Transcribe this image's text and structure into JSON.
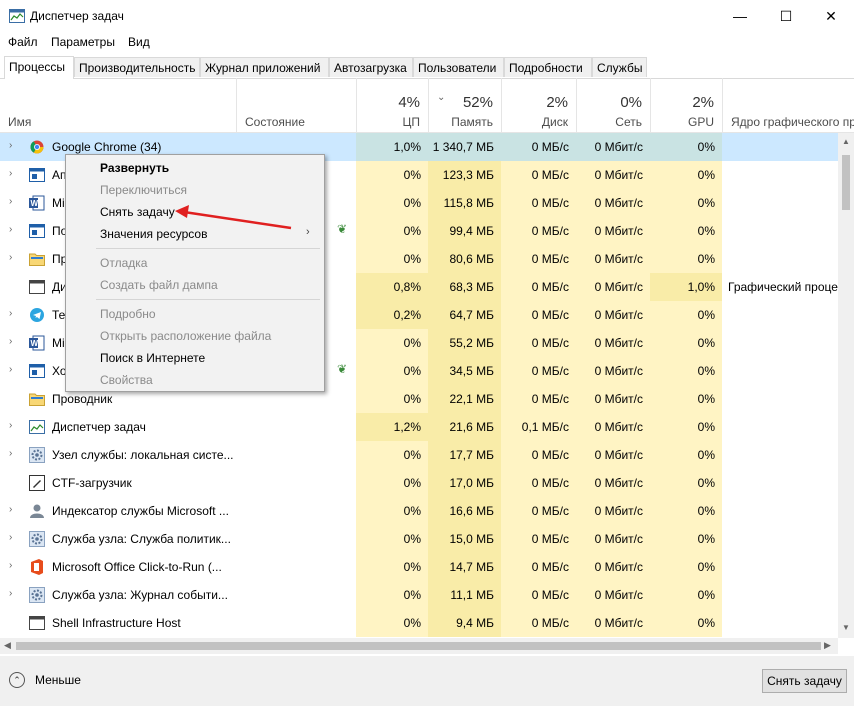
{
  "window": {
    "title": "Диспетчер задач",
    "minimize": "—",
    "maximize": "☐",
    "close": "✕"
  },
  "menu": [
    "Файл",
    "Параметры",
    "Вид"
  ],
  "tabs": [
    "Процессы",
    "Производительность",
    "Журнал приложений",
    "Автозагрузка",
    "Пользователи",
    "Подробности",
    "Службы"
  ],
  "columns": {
    "name": "Имя",
    "status": "Состояние",
    "cpu": {
      "pct": "4%",
      "label": "ЦП"
    },
    "mem": {
      "pct": "52%",
      "label": "Память"
    },
    "disk": {
      "pct": "2%",
      "label": "Диск"
    },
    "net": {
      "pct": "0%",
      "label": "Сеть"
    },
    "gpu": {
      "pct": "2%",
      "label": "GPU"
    },
    "engine": "Ядро графического процессора"
  },
  "processes": [
    {
      "name": "Google Chrome (34)",
      "cpu": "1,0%",
      "mem": "1 340,7 МБ",
      "disk": "0 МБ/с",
      "net": "0 Мбит/с",
      "gpu": "0%",
      "engine": "",
      "icon": "chrome-icon"
    },
    {
      "name": "Ап",
      "cpu": "0%",
      "mem": "123,3 МБ",
      "disk": "0 МБ/с",
      "net": "0 Мбит/с",
      "gpu": "0%",
      "engine": "",
      "icon": "app-window-icon"
    },
    {
      "name": "Mi",
      "cpu": "0%",
      "mem": "115,8 МБ",
      "disk": "0 МБ/с",
      "net": "0 Мбит/с",
      "gpu": "0%",
      "engine": "",
      "icon": "word-icon"
    },
    {
      "name": "По",
      "cpu": "0%",
      "mem": "99,4 МБ",
      "disk": "0 МБ/с",
      "net": "0 Мбит/с",
      "gpu": "0%",
      "engine": "",
      "icon": "app-window-icon",
      "leaf": true
    },
    {
      "name": "Пр",
      "cpu": "0%",
      "mem": "80,6 МБ",
      "disk": "0 МБ/с",
      "net": "0 Мбит/с",
      "gpu": "0%",
      "engine": "",
      "icon": "folder-icon"
    },
    {
      "name": "Ди",
      "cpu": "0,8%",
      "mem": "68,3 МБ",
      "disk": "0 МБ/с",
      "net": "0 Мбит/с",
      "gpu": "1,0%",
      "engine": "Графический процессор",
      "icon": "window-icon"
    },
    {
      "name": "Те",
      "cpu": "0,2%",
      "mem": "64,7 МБ",
      "disk": "0 МБ/с",
      "net": "0 Мбит/с",
      "gpu": "0%",
      "engine": "",
      "icon": "telegram-icon"
    },
    {
      "name": "Mi",
      "cpu": "0%",
      "mem": "55,2 МБ",
      "disk": "0 МБ/с",
      "net": "0 Мбит/с",
      "gpu": "0%",
      "engine": "",
      "icon": "word-icon"
    },
    {
      "name": "Хо",
      "cpu": "0%",
      "mem": "34,5 МБ",
      "disk": "0 МБ/с",
      "net": "0 Мбит/с",
      "gpu": "0%",
      "engine": "",
      "icon": "app-window-icon",
      "leaf": true
    },
    {
      "name": "Проводник",
      "cpu": "0%",
      "mem": "22,1 МБ",
      "disk": "0 МБ/с",
      "net": "0 Мбит/с",
      "gpu": "0%",
      "engine": "",
      "icon": "folder-icon"
    },
    {
      "name": "Диспетчер задач",
      "cpu": "1,2%",
      "mem": "21,6 МБ",
      "disk": "0,1 МБ/с",
      "net": "0 Мбит/с",
      "gpu": "0%",
      "engine": "",
      "icon": "taskmgr-icon"
    },
    {
      "name": "Узел службы: локальная систе...",
      "cpu": "0%",
      "mem": "17,7 МБ",
      "disk": "0 МБ/с",
      "net": "0 Мбит/с",
      "gpu": "0%",
      "engine": "",
      "icon": "gear-icon"
    },
    {
      "name": "CTF-загрузчик",
      "cpu": "0%",
      "mem": "17,0 МБ",
      "disk": "0 МБ/с",
      "net": "0 Мбит/с",
      "gpu": "0%",
      "engine": "",
      "icon": "pen-icon"
    },
    {
      "name": "Индексатор службы Microsoft ...",
      "cpu": "0%",
      "mem": "16,6 МБ",
      "disk": "0 МБ/с",
      "net": "0 Мбит/с",
      "gpu": "0%",
      "engine": "",
      "icon": "user-icon"
    },
    {
      "name": "Служба узла: Служба политик...",
      "cpu": "0%",
      "mem": "15,0 МБ",
      "disk": "0 МБ/с",
      "net": "0 Мбит/с",
      "gpu": "0%",
      "engine": "",
      "icon": "gear-icon"
    },
    {
      "name": "Microsoft Office Click-to-Run (...",
      "cpu": "0%",
      "mem": "14,7 МБ",
      "disk": "0 МБ/с",
      "net": "0 Мбит/с",
      "gpu": "0%",
      "engine": "",
      "icon": "office-icon"
    },
    {
      "name": "Служба узла: Журнал событи...",
      "cpu": "0%",
      "mem": "11,1 МБ",
      "disk": "0 МБ/с",
      "net": "0 Мбит/с",
      "gpu": "0%",
      "engine": "",
      "icon": "gear-icon"
    },
    {
      "name": "Shell Infrastructure Host",
      "cpu": "0%",
      "mem": "9,4 МБ",
      "disk": "0 МБ/с",
      "net": "0 Мбит/с",
      "gpu": "0%",
      "engine": "",
      "icon": "window-icon"
    }
  ],
  "context_menu": {
    "expand": "Развернуть",
    "switch_to": "Переключиться",
    "end_task": "Снять задачу",
    "resource_values": "Значения ресурсов",
    "debug": "Отладка",
    "create_dump": "Создать файл дампа",
    "details": "Подробно",
    "open_location": "Открыть расположение файла",
    "search_online": "Поиск в Интернете",
    "properties": "Свойства"
  },
  "footer": {
    "less_details": "Меньше",
    "end_task_button": "Снять задачу"
  },
  "colors": {
    "selected_row": "#cce8ff",
    "heat_light": "#fff4c4",
    "heat_medium": "#f9eca8",
    "annotation_arrow": "#e02020"
  }
}
